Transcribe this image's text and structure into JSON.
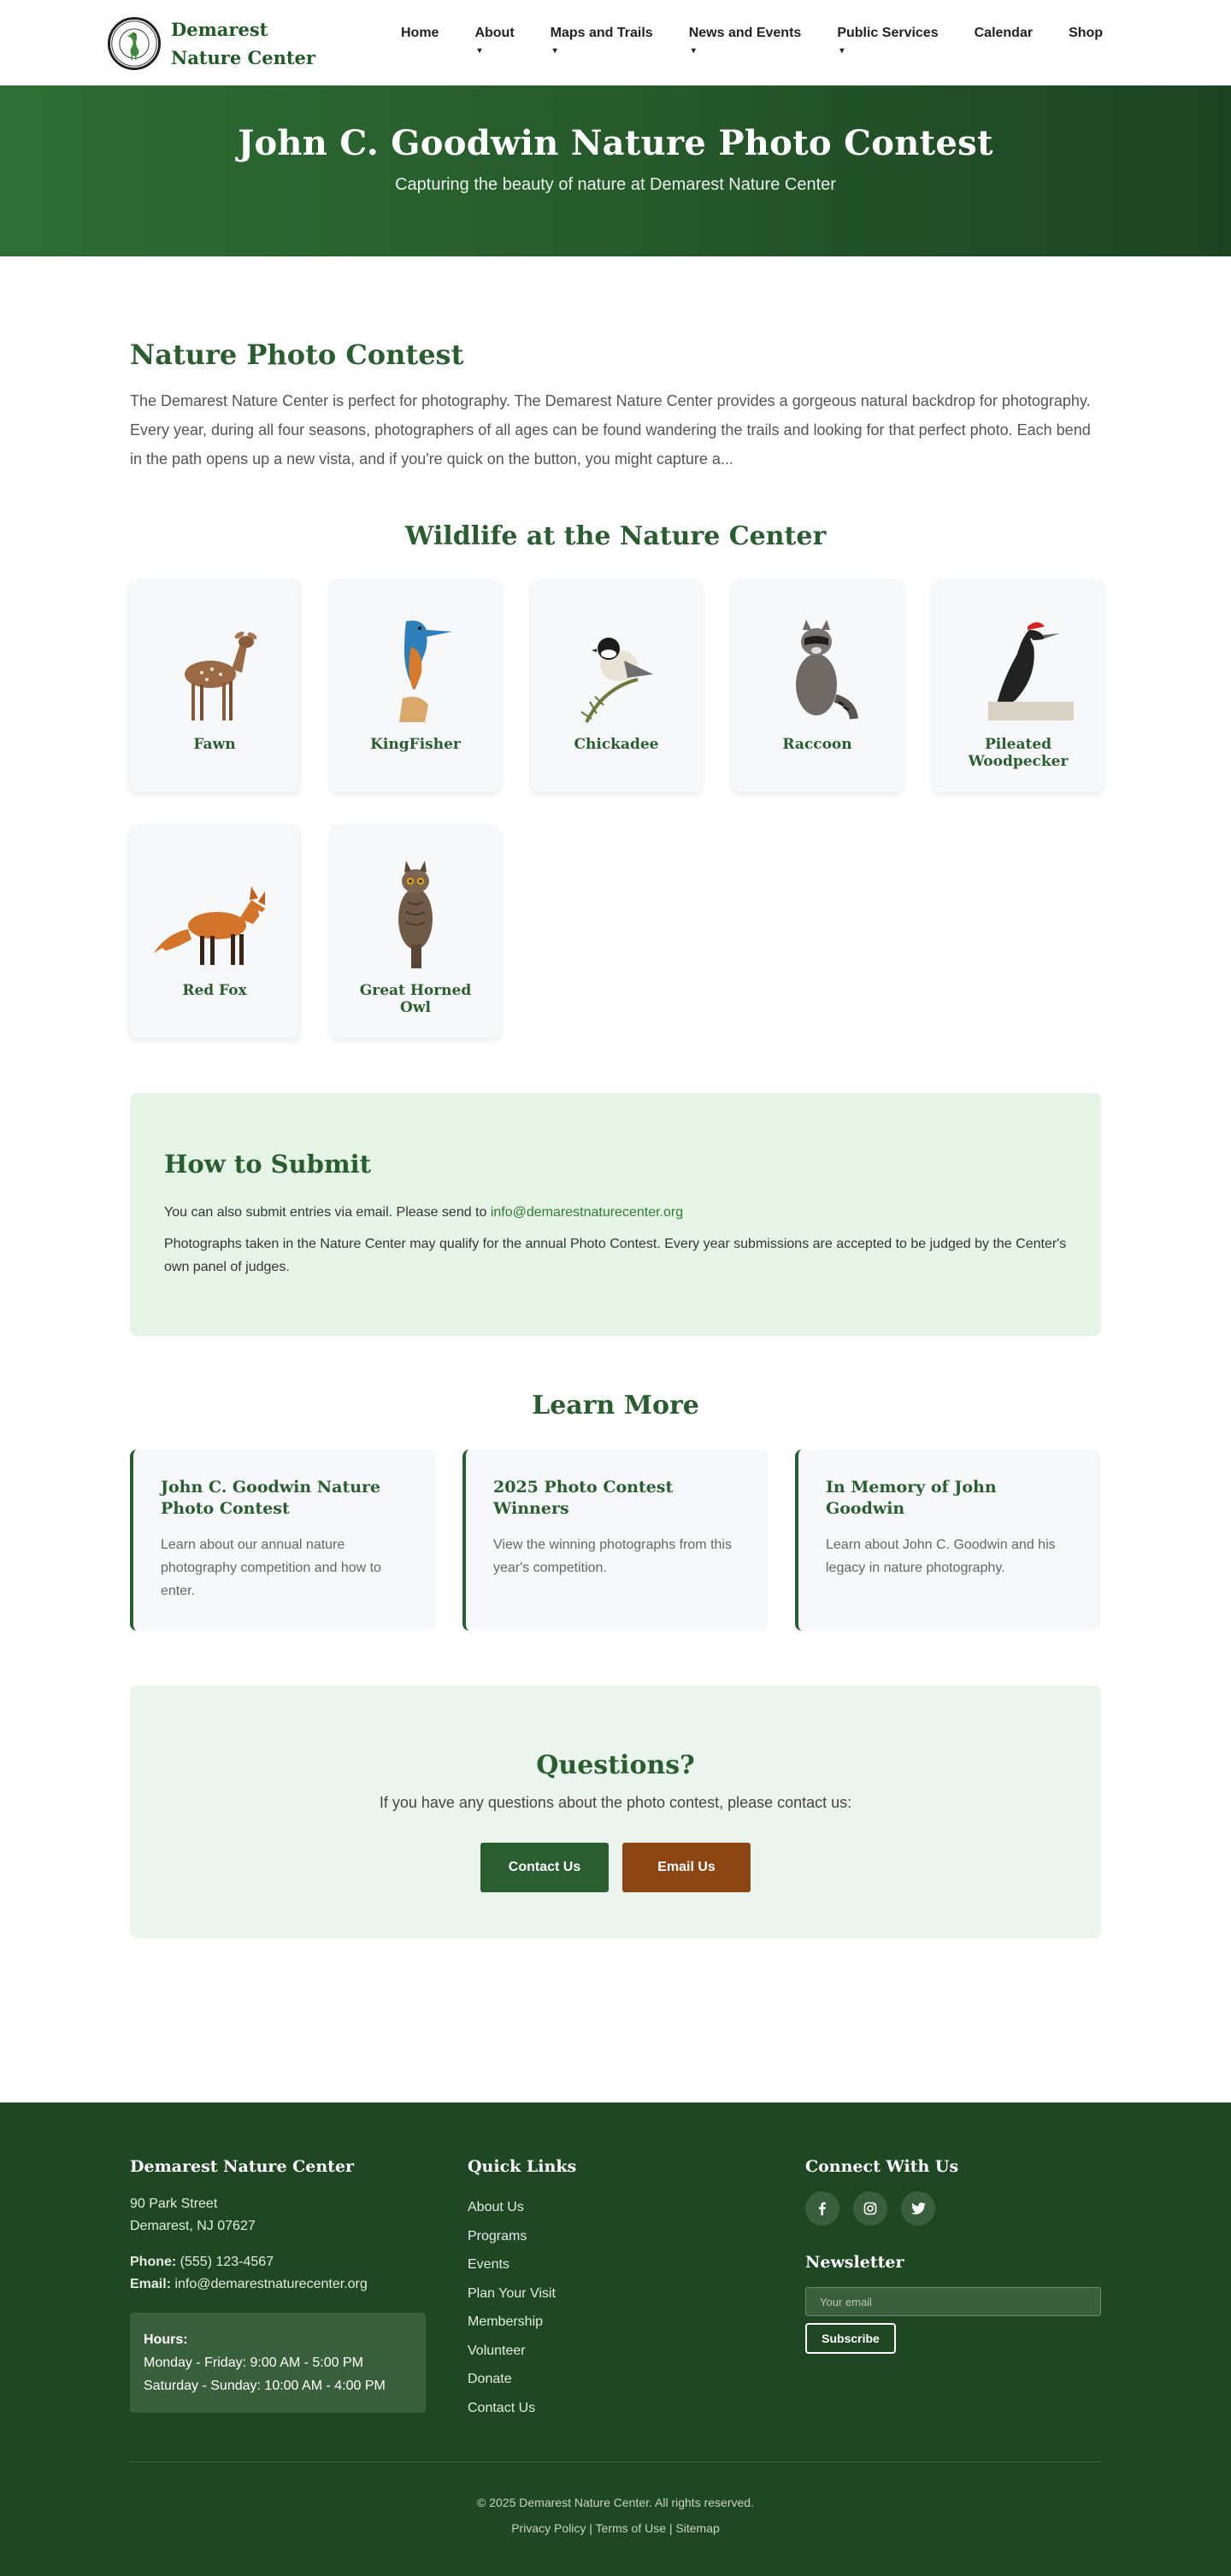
{
  "header": {
    "site_name": "Demarest Nature Center",
    "logo_text": "DEMAREST NATURE CENTER",
    "nav": [
      {
        "label": "Home",
        "dropdown": false
      },
      {
        "label": "About",
        "dropdown": true
      },
      {
        "label": "Maps and Trails",
        "dropdown": true
      },
      {
        "label": "News and Events",
        "dropdown": true
      },
      {
        "label": "Public Services",
        "dropdown": true
      },
      {
        "label": "Calendar",
        "dropdown": false
      },
      {
        "label": "Shop",
        "dropdown": false
      }
    ],
    "caret": "▾"
  },
  "hero": {
    "title": "John C. Goodwin Nature Photo Contest",
    "subtitle": "Capturing the beauty of nature at Demarest Nature Center"
  },
  "intro": {
    "heading": "Nature Photo Contest",
    "text": "The Demarest Nature Center is perfect for photography. The Demarest Nature Center provides a gorgeous natural backdrop for photography. Every year, during all four seasons, photographers of all ages can be found wandering the trails and looking for that perfect photo. Each bend in the path opens up a new vista, and if you're quick on the button, you might capture a..."
  },
  "wildlife": {
    "heading": "Wildlife at the Nature Center",
    "animals": [
      {
        "name": "Fawn"
      },
      {
        "name": "KingFisher"
      },
      {
        "name": "Chickadee"
      },
      {
        "name": "Raccoon"
      },
      {
        "name": "Pileated Woodpecker"
      },
      {
        "name": "Red Fox"
      },
      {
        "name": "Great Horned Owl"
      }
    ]
  },
  "submit": {
    "heading": "How to Submit",
    "line1_prefix": "You can also submit entries via email. Please send to ",
    "email": "info@demarestnaturecenter.org",
    "line2": "Photographs taken in the Nature Center may qualify for the annual Photo Contest. Every year submissions are accepted to be judged by the Center's own panel of judges."
  },
  "learn_more": {
    "heading": "Learn More",
    "cards": [
      {
        "title": "John C. Goodwin Nature Photo Contest",
        "text": "Learn about our annual nature photography competition and how to enter."
      },
      {
        "title": "2025 Photo Contest Winners",
        "text": "View the winning photographs from this year's competition."
      },
      {
        "title": "In Memory of John Goodwin",
        "text": "Learn about John C. Goodwin and his legacy in nature photography."
      }
    ]
  },
  "questions": {
    "heading": "Questions?",
    "text": "If you have any questions about the photo contest, please contact us:",
    "contact_button": "Contact Us",
    "email_button": "Email Us"
  },
  "footer": {
    "org": {
      "heading": "Demarest Nature Center",
      "address_line1": "90 Park Street",
      "address_line2": "Demarest, NJ 07627",
      "phone_label": "Phone:",
      "phone": "(555) 123-4567",
      "email_label": "Email:",
      "email": "info@demarestnaturecenter.org",
      "hours_label": "Hours:",
      "hours_weekday": "Monday - Friday: 9:00 AM - 5:00 PM",
      "hours_weekend": "Saturday - Sunday: 10:00 AM - 4:00 PM"
    },
    "quick_links": {
      "heading": "Quick Links",
      "links": [
        "About Us",
        "Programs",
        "Events",
        "Plan Your Visit",
        "Membership",
        "Volunteer",
        "Donate",
        "Contact Us"
      ]
    },
    "connect": {
      "heading": "Connect With Us",
      "social": [
        "facebook-icon",
        "instagram-icon",
        "twitter-icon"
      ]
    },
    "newsletter": {
      "heading": "Newsletter",
      "placeholder": "Your email",
      "button": "Subscribe"
    },
    "copyright": "© 2025 Demarest Nature Center. All rights reserved.",
    "legal_links": [
      "Privacy Policy",
      "Terms of Use",
      "Sitemap"
    ],
    "separator": " | "
  },
  "colors": {
    "brand_green": "#2a5e30",
    "footer_green": "#1f4723",
    "accent_brown": "#8b4513",
    "submit_bg": "#e6f4e6"
  }
}
